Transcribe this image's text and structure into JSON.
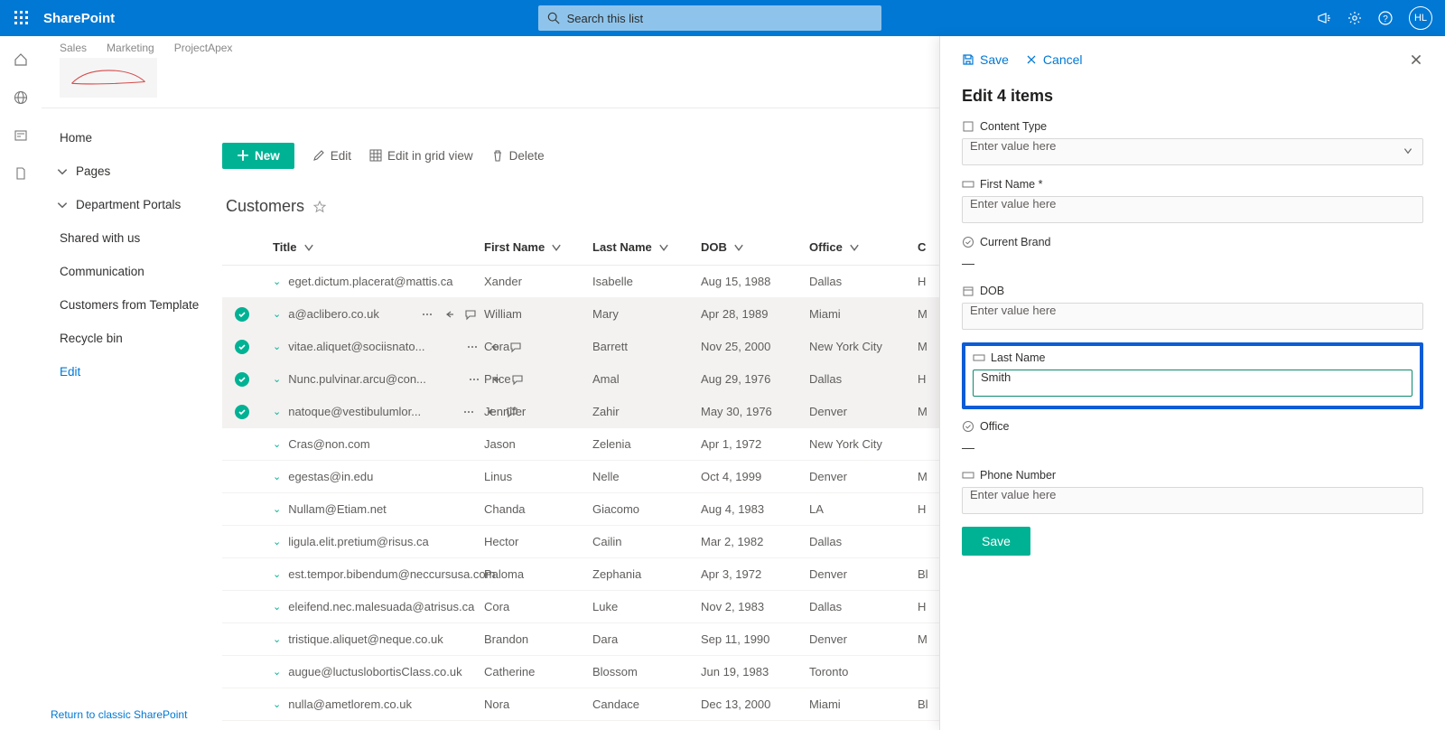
{
  "brand": "SharePoint",
  "search": {
    "placeholder": "Search this list"
  },
  "hub_nav": [
    "Sales",
    "Marketing",
    "ProjectApex"
  ],
  "avatar_initials": "HL",
  "left_nav": {
    "home": "Home",
    "pages": "Pages",
    "dept": "Department Portals",
    "shared": "Shared with us",
    "communication": "Communication",
    "customers_tpl": "Customers from Template",
    "recycle": "Recycle bin",
    "edit": "Edit"
  },
  "footer_link": "Return to classic SharePoint",
  "cmdbar": {
    "new": "New",
    "edit": "Edit",
    "grid": "Edit in grid view",
    "delete": "Delete"
  },
  "list_title": "Customers",
  "columns": {
    "title": "Title",
    "first": "First Name",
    "last": "Last Name",
    "dob": "DOB",
    "office": "Office",
    "extra": "C"
  },
  "rows": [
    {
      "sel": false,
      "title": "eget.dictum.placerat@mattis.ca",
      "first": "Xander",
      "last": "Isabelle",
      "dob": "Aug 15, 1988",
      "office": "Dallas",
      "ext": "H"
    },
    {
      "sel": true,
      "title": "a@aclibero.co.uk",
      "first": "William",
      "last": "Mary",
      "dob": "Apr 28, 1989",
      "office": "Miami",
      "ext": "M"
    },
    {
      "sel": true,
      "title": "vitae.aliquet@sociisnato...",
      "first": "Cora",
      "last": "Barrett",
      "dob": "Nov 25, 2000",
      "office": "New York City",
      "ext": "M"
    },
    {
      "sel": true,
      "title": "Nunc.pulvinar.arcu@con...",
      "first": "Price",
      "last": "Amal",
      "dob": "Aug 29, 1976",
      "office": "Dallas",
      "ext": "H"
    },
    {
      "sel": true,
      "title": "natoque@vestibulumlor...",
      "first": "Jennifer",
      "last": "Zahir",
      "dob": "May 30, 1976",
      "office": "Denver",
      "ext": "M"
    },
    {
      "sel": false,
      "title": "Cras@non.com",
      "first": "Jason",
      "last": "Zelenia",
      "dob": "Apr 1, 1972",
      "office": "New York City",
      "ext": ""
    },
    {
      "sel": false,
      "title": "egestas@in.edu",
      "first": "Linus",
      "last": "Nelle",
      "dob": "Oct 4, 1999",
      "office": "Denver",
      "ext": "M"
    },
    {
      "sel": false,
      "title": "Nullam@Etiam.net",
      "first": "Chanda",
      "last": "Giacomo",
      "dob": "Aug 4, 1983",
      "office": "LA",
      "ext": "H"
    },
    {
      "sel": false,
      "title": "ligula.elit.pretium@risus.ca",
      "first": "Hector",
      "last": "Cailin",
      "dob": "Mar 2, 1982",
      "office": "Dallas",
      "ext": ""
    },
    {
      "sel": false,
      "title": "est.tempor.bibendum@neccursusa.com",
      "first": "Paloma",
      "last": "Zephania",
      "dob": "Apr 3, 1972",
      "office": "Denver",
      "ext": "Bl"
    },
    {
      "sel": false,
      "title": "eleifend.nec.malesuada@atrisus.ca",
      "first": "Cora",
      "last": "Luke",
      "dob": "Nov 2, 1983",
      "office": "Dallas",
      "ext": "H"
    },
    {
      "sel": false,
      "title": "tristique.aliquet@neque.co.uk",
      "first": "Brandon",
      "last": "Dara",
      "dob": "Sep 11, 1990",
      "office": "Denver",
      "ext": "M"
    },
    {
      "sel": false,
      "title": "augue@luctuslobortisClass.co.uk",
      "first": "Catherine",
      "last": "Blossom",
      "dob": "Jun 19, 1983",
      "office": "Toronto",
      "ext": ""
    },
    {
      "sel": false,
      "title": "nulla@ametlorem.co.uk",
      "first": "Nora",
      "last": "Candace",
      "dob": "Dec 13, 2000",
      "office": "Miami",
      "ext": "Bl"
    }
  ],
  "panel": {
    "save": "Save",
    "cancel": "Cancel",
    "heading": "Edit 4 items",
    "content_type_label": "Content Type",
    "placeholder": "Enter value here",
    "first_name_label": "First Name *",
    "current_brand_label": "Current Brand",
    "dash": "—",
    "dob_label": "DOB",
    "last_name_label": "Last Name",
    "last_name_value": "Smith",
    "office_label": "Office",
    "phone_label": "Phone Number",
    "btn_save": "Save"
  }
}
